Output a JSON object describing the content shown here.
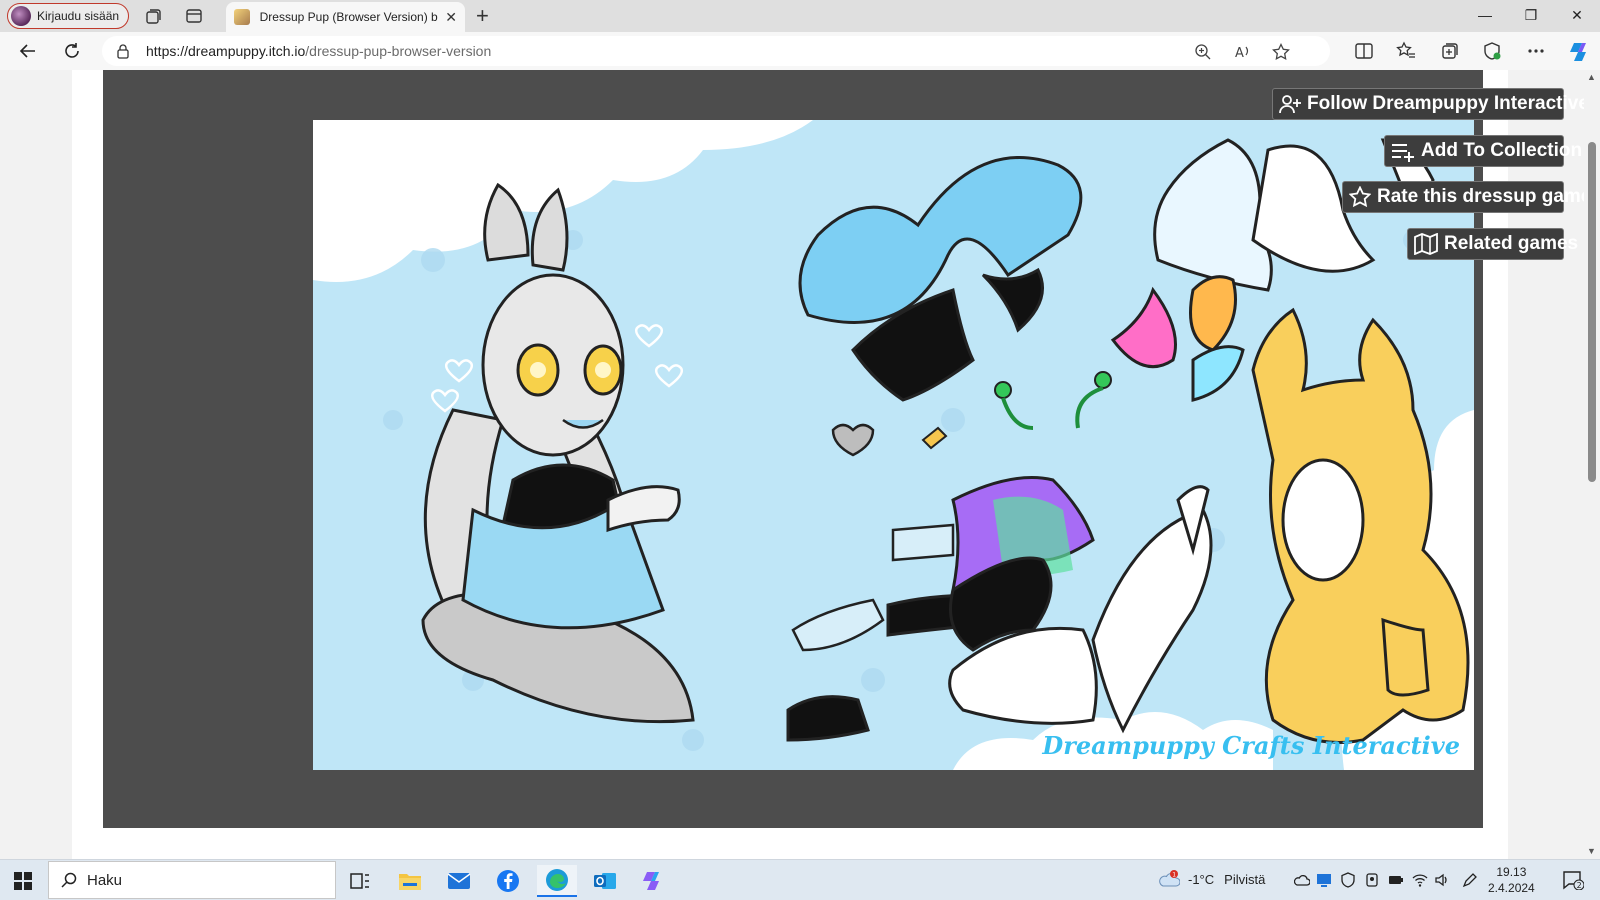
{
  "browser": {
    "profile_label": "Kirjaudu sisään",
    "tab_title": "Dressup Pup (Browser Version) b",
    "tab_close": "✕",
    "new_tab": "+",
    "url_host": "https://dreampuppy.itch.io",
    "url_path": "/dressup-pup-browser-version",
    "window_minimize": "—",
    "window_restore": "❐",
    "window_close": "✕"
  },
  "game": {
    "watermark": "Dreampuppy Crafts Interactive"
  },
  "user_tools": {
    "follow_label": "Follow Dreampuppy Interactive",
    "add_collection_label": "Add To Collection",
    "rate_label": "Rate this dressup game",
    "related_label": "Related games"
  },
  "taskbar": {
    "search_placeholder": "Haku",
    "weather_temp": "-1°C",
    "weather_desc": "Pilvistä",
    "weather_badge": "1",
    "time": "19.13",
    "date": "2.4.2024",
    "notification_count": "2"
  },
  "colors": {
    "accent": "#1a73e8",
    "frame_bg": "#4d4d4d",
    "canvas_bg": "#bfe6f7",
    "watermark": "#38bff0",
    "profile_border": "#c0392b"
  }
}
